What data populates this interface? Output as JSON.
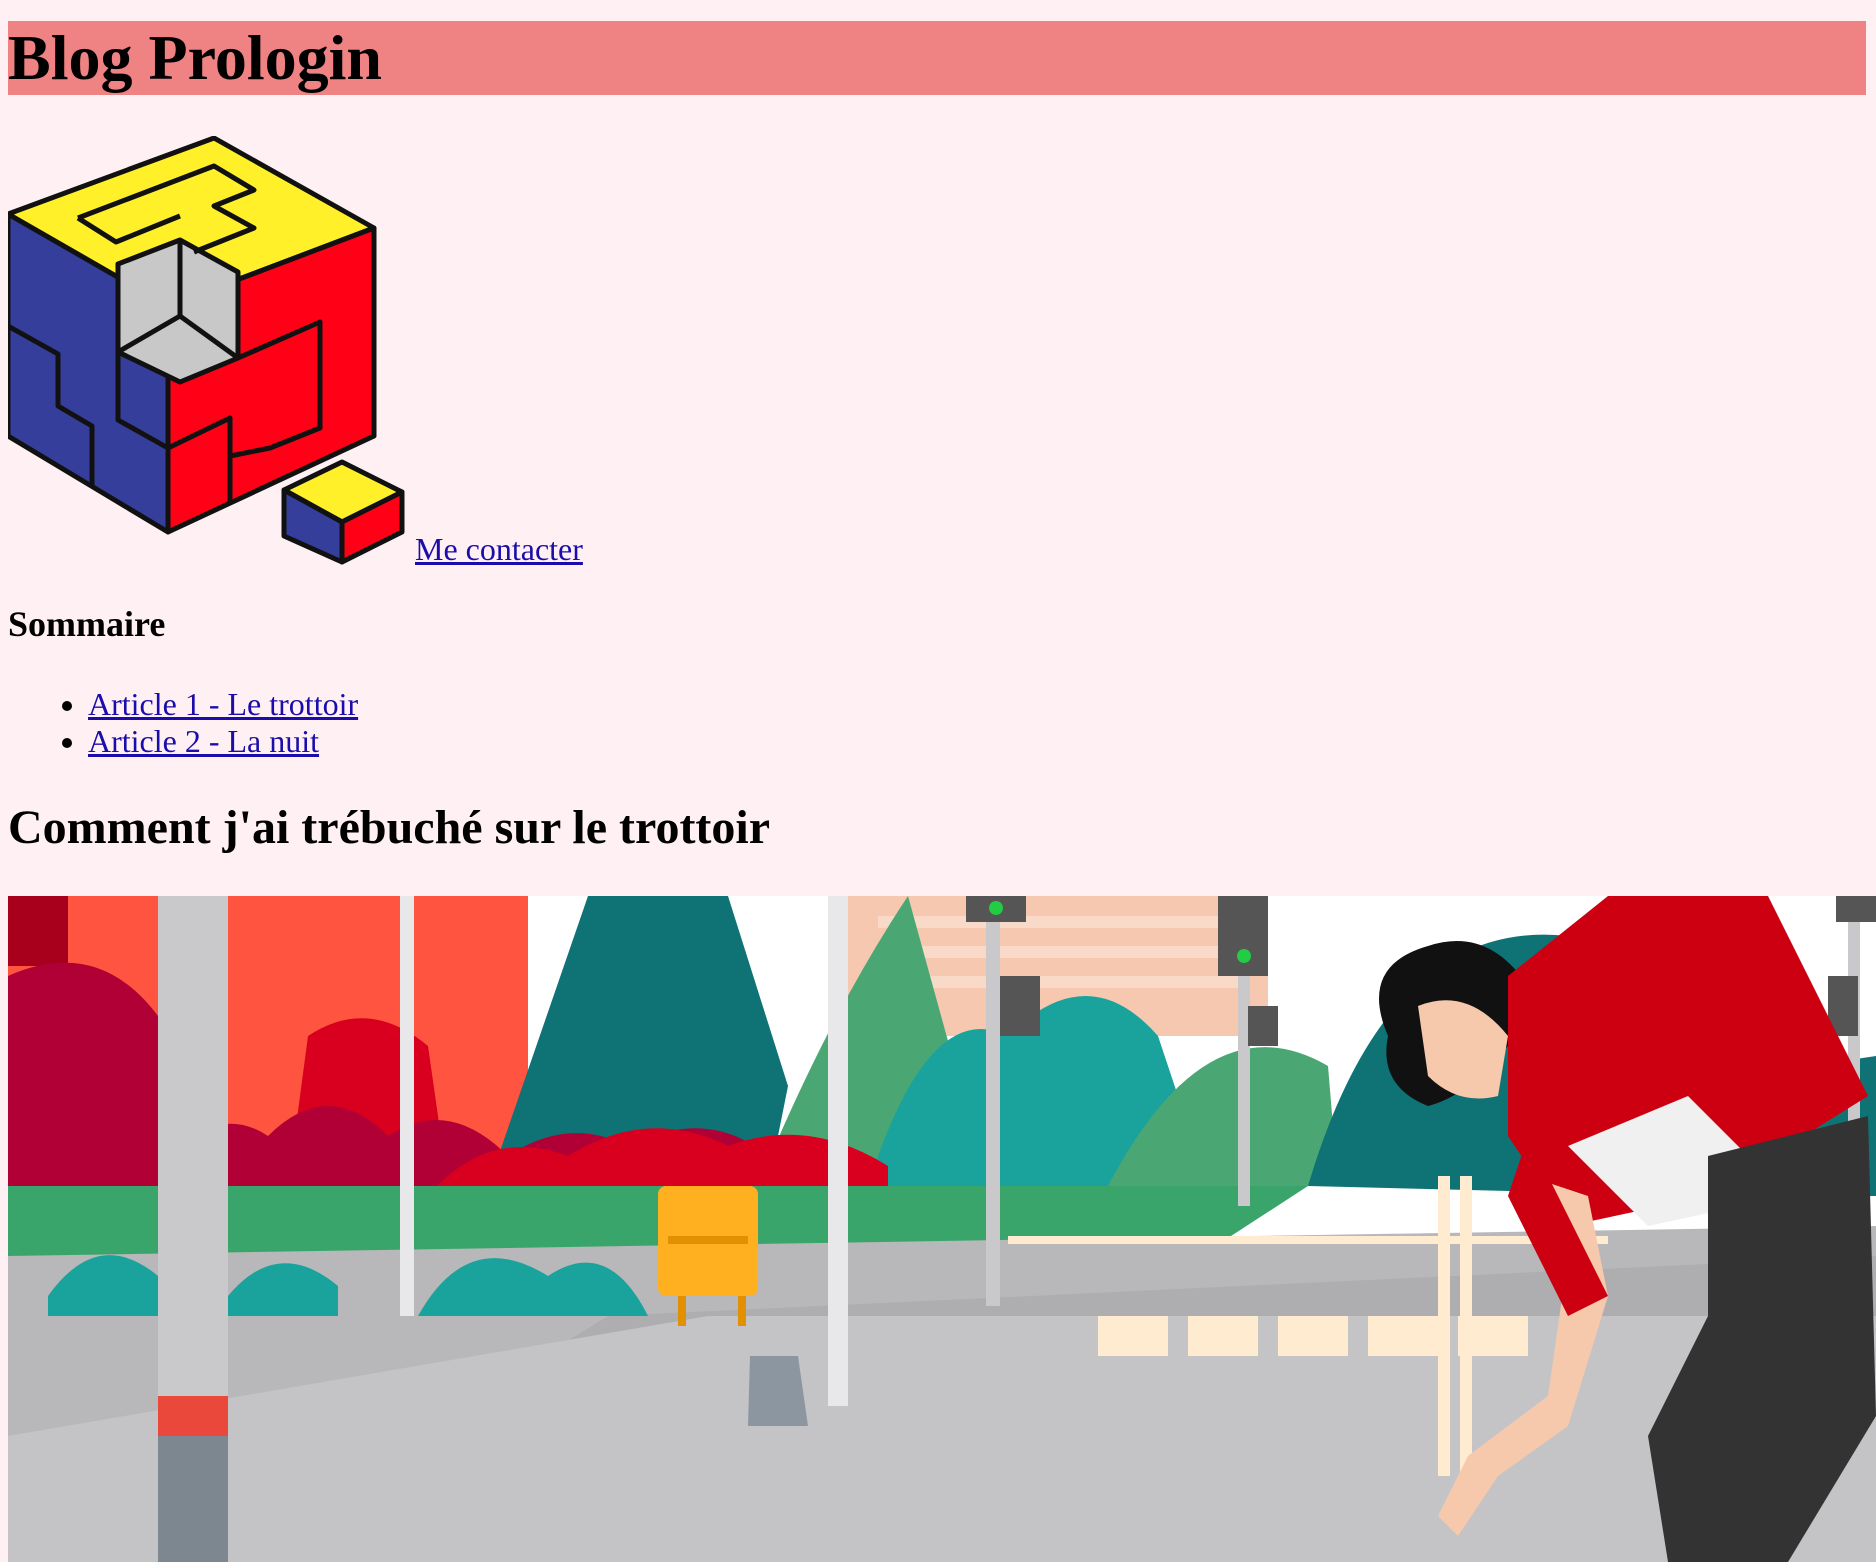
{
  "site": {
    "title": "Blog Prologin"
  },
  "header": {
    "contact_label": " Me contacter"
  },
  "summary": {
    "title": "Sommaire",
    "items": [
      {
        "label": "Article 1 - Le trottoir"
      },
      {
        "label": "Article 2 - La nuit"
      }
    ]
  },
  "article": {
    "title": "Comment j'ai trébuché sur le trottoir"
  },
  "colors": {
    "background": "#fff0f3",
    "header_bar": "#ef8282",
    "link": "#1a0dab"
  },
  "icons": {
    "logo": "prologin-cube-logo",
    "hero": "street-illustration"
  }
}
